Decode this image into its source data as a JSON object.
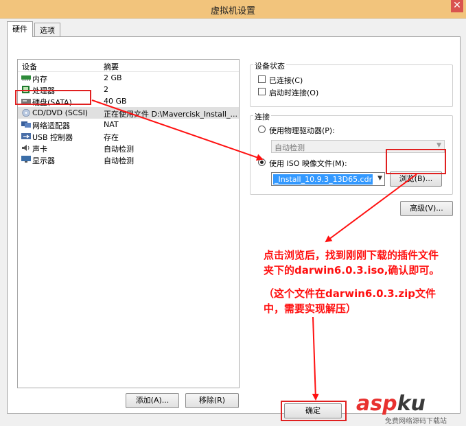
{
  "window": {
    "title": "虚拟机设置"
  },
  "tabs": [
    {
      "label": "硬件"
    },
    {
      "label": "选项"
    }
  ],
  "device_list": {
    "col_device": "设备",
    "col_summary": "摘要",
    "rows": [
      {
        "device": "内存",
        "summary": "2 GB",
        "icon": "memory-icon"
      },
      {
        "device": "处理器",
        "summary": "2",
        "icon": "processor-icon"
      },
      {
        "device": "硬盘(SATA)",
        "summary": "40 GB",
        "icon": "hard-disk-icon"
      },
      {
        "device": "CD/DVD (SCSI)",
        "summary": "正在使用文件 D:\\Mavercisk_Install_...",
        "icon": "cd-dvd-icon"
      },
      {
        "device": "网络适配器",
        "summary": "NAT",
        "icon": "network-adapter-icon"
      },
      {
        "device": "USB 控制器",
        "summary": "存在",
        "icon": "usb-controller-icon"
      },
      {
        "device": "声卡",
        "summary": "自动检测",
        "icon": "sound-card-icon"
      },
      {
        "device": "显示器",
        "summary": "自动检测",
        "icon": "display-icon"
      }
    ],
    "add_label": "添加(A)...",
    "remove_label": "移除(R)"
  },
  "device_status": {
    "title": "设备状态",
    "connected_label": "已连接(C)",
    "connect_at_power_on_label": "启动时连接(O)"
  },
  "connection": {
    "title": "连接",
    "physical_label": "使用物理驱动器(P):",
    "physical_value": "自动检测",
    "iso_label": "使用 ISO 映像文件(M):",
    "iso_value": "_Install_10.9.3_13D65.cdr",
    "browse_label": "浏览(B)...",
    "selected": "iso"
  },
  "advanced_label": "高级(V)...",
  "ok_label": "确定",
  "annotation": {
    "line1": "点击浏览后，找到刚刚下载的插件文件",
    "line2": "夹下的darwin6.0.3.iso,确认即可。",
    "line3": "（这个文件在darwin6.0.3.zip文件",
    "line4": "中，需要实现解压）"
  },
  "watermark": {
    "brand_a": "asp",
    "brand_b": "ku",
    "sub": "免费网络源码下载站"
  },
  "colors": {
    "annotation": "#ff1010",
    "title_bar": "#f2c47c",
    "selection": "#3399ff"
  }
}
